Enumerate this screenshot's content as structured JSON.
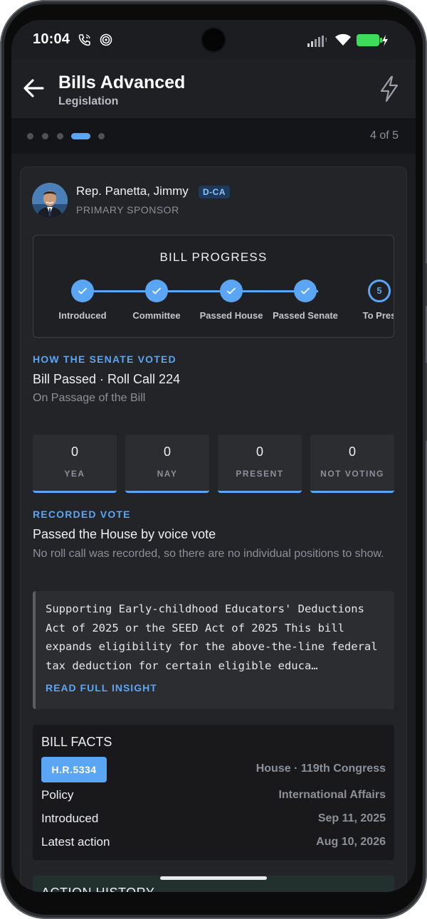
{
  "status_bar": {
    "time": "10:04",
    "icons": [
      "phone-wifi-call-icon",
      "hotspot-icon",
      "cellular-signal-icon",
      "wifi-icon",
      "battery-charging-icon"
    ],
    "battery_color": "#3ddc5a"
  },
  "header": {
    "title": "Bills Advanced",
    "subtitle": "Legislation",
    "back_icon": "arrow-left-icon",
    "action_icon": "bolt-icon"
  },
  "pager": {
    "dots": 5,
    "active_index": 3,
    "count_label": "4 of 5"
  },
  "sponsor": {
    "name": "Rep. Panetta, Jimmy",
    "party": "D-CA",
    "role": "PRIMARY SPONSOR"
  },
  "bill_progress": {
    "title": "BILL PROGRESS",
    "steps": [
      {
        "label": "Introduced",
        "done": true
      },
      {
        "label": "Committee",
        "done": true
      },
      {
        "label": "Passed House",
        "done": true
      },
      {
        "label": "Passed Senate",
        "done": true
      },
      {
        "label": "To Pres",
        "done": false,
        "number": "5"
      }
    ]
  },
  "senate_vote": {
    "section_label": "HOW THE SENATE VOTED",
    "result": "Bill Passed · Roll Call 224",
    "question": "On Passage of the Bill",
    "tallies": [
      {
        "value": "0",
        "label": "YEA"
      },
      {
        "value": "0",
        "label": "NAY"
      },
      {
        "value": "0",
        "label": "PRESENT"
      },
      {
        "value": "0",
        "label": "NOT VOTING"
      }
    ]
  },
  "recorded_vote": {
    "section_label": "RECORDED VOTE",
    "result": "Passed the House by voice vote",
    "note": "No roll call was recorded, so there are no individual positions to show."
  },
  "insight": {
    "text": "Supporting Early-childhood Educators' Deductions Act of 2025 or the SEED Act of 2025 This bill expands eligibility for the above-the-line federal tax deduction for certain eligible educa…",
    "link_label": "READ FULL INSIGHT"
  },
  "bill_facts": {
    "title": "BILL FACTS",
    "bill_number": "H.R.5334",
    "chamber_congress": "House · 119th Congress",
    "rows": [
      {
        "label": "Policy",
        "value": "International Affairs"
      },
      {
        "label": "Introduced",
        "value": "Sep 11, 2025"
      },
      {
        "label": "Latest action",
        "value": "Aug 10, 2026"
      }
    ]
  },
  "action_history": {
    "title": "ACTION HISTORY"
  },
  "colors": {
    "accent": "#5aa6f5",
    "background": "#1b1c1f",
    "card": "#232428"
  }
}
